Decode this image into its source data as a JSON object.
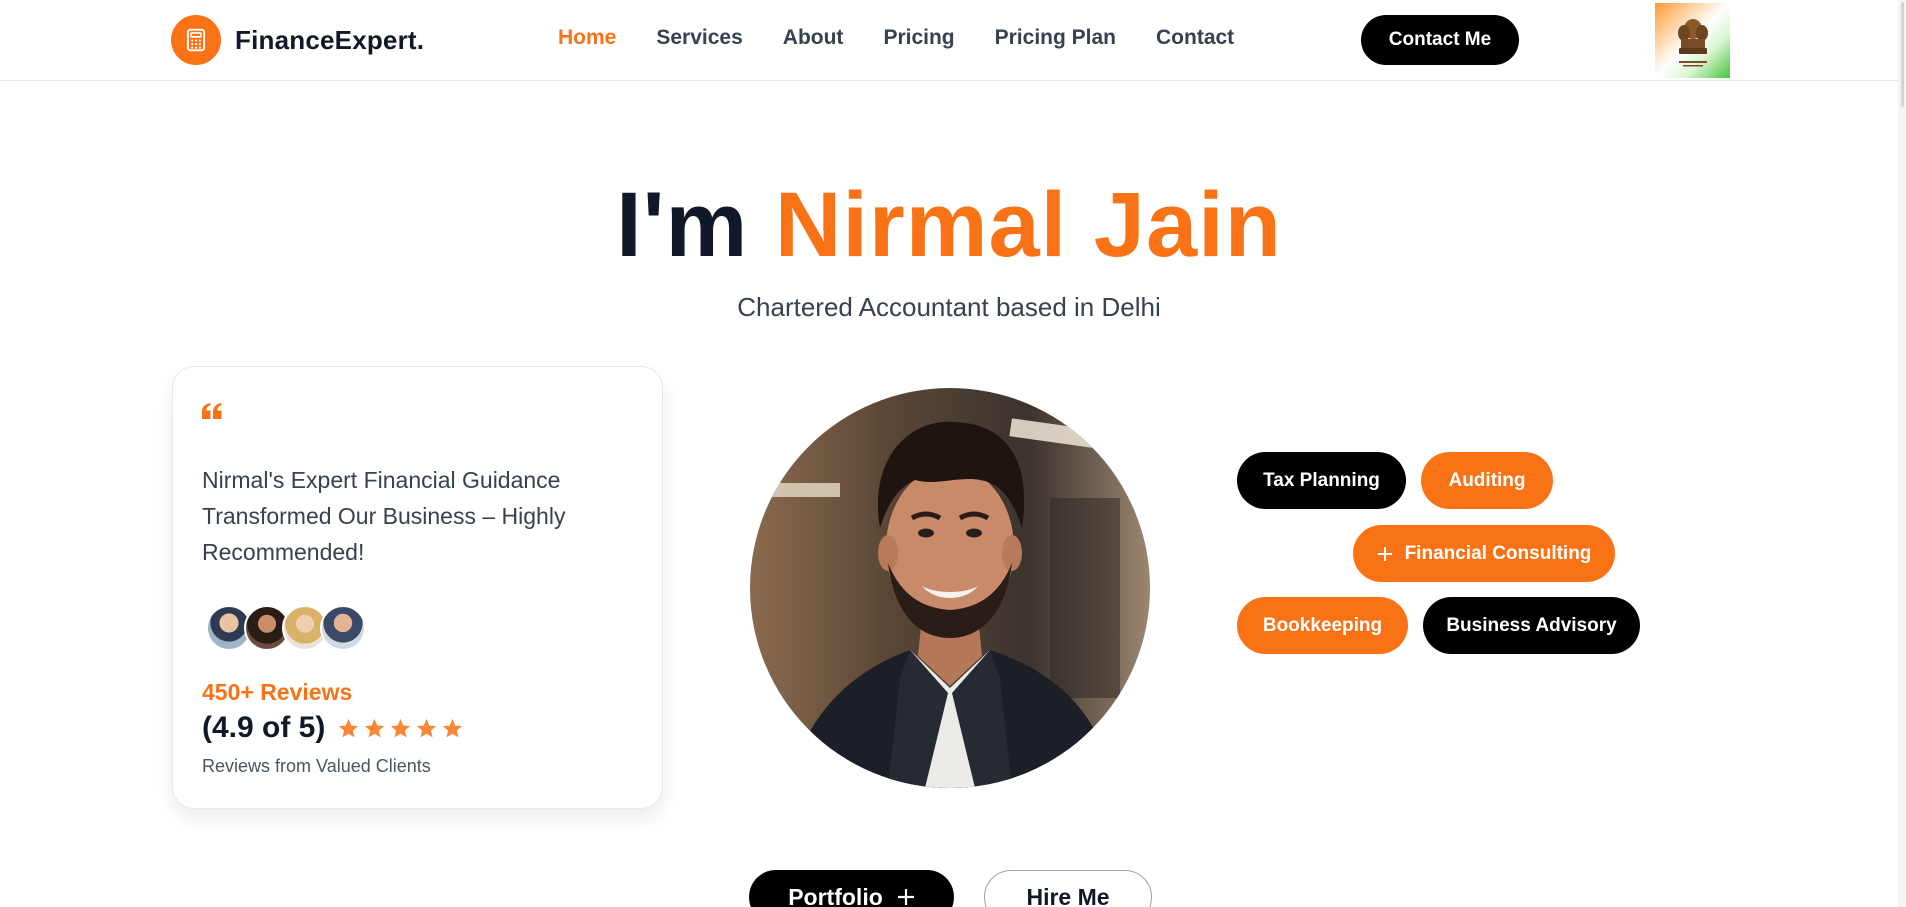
{
  "brand": {
    "name": "FinanceExpert.",
    "icon": "calculator-icon",
    "accent": "#f97316"
  },
  "nav": {
    "links": [
      {
        "label": "Home",
        "active": true
      },
      {
        "label": "Services",
        "active": false
      },
      {
        "label": "About",
        "active": false
      },
      {
        "label": "Pricing",
        "active": false
      },
      {
        "label": "Pricing Plan",
        "active": false
      },
      {
        "label": "Contact",
        "active": false
      }
    ],
    "cta_label": "Contact Me",
    "emblem_icon": "national-emblem-icon"
  },
  "hero": {
    "greeting": "I'm",
    "name": "Nirmal Jain",
    "subtitle": "Chartered Accountant based in Delhi"
  },
  "testimonial": {
    "quote_icon": "quote-icon",
    "quote": "Nirmal's Expert Financial Guidance Transformed Our Business – Highly Recommended!",
    "reviews_count": "450+ Reviews",
    "rating": "(4.9 of 5)",
    "stars": 5,
    "note": "Reviews from Valued Clients"
  },
  "tags": [
    {
      "label": "Tax Planning",
      "style": "black"
    },
    {
      "label": "Auditing",
      "style": "orange"
    },
    {
      "label": "Financial Consulting",
      "style": "orange",
      "icon": "plus-icon"
    },
    {
      "label": "Bookkeeping",
      "style": "orange"
    },
    {
      "label": "Business Advisory",
      "style": "black"
    }
  ],
  "actions": {
    "portfolio_label": "Portfolio",
    "hire_label": "Hire Me"
  },
  "colors": {
    "accent": "#f97316",
    "dark": "#111827",
    "black": "#000000"
  }
}
